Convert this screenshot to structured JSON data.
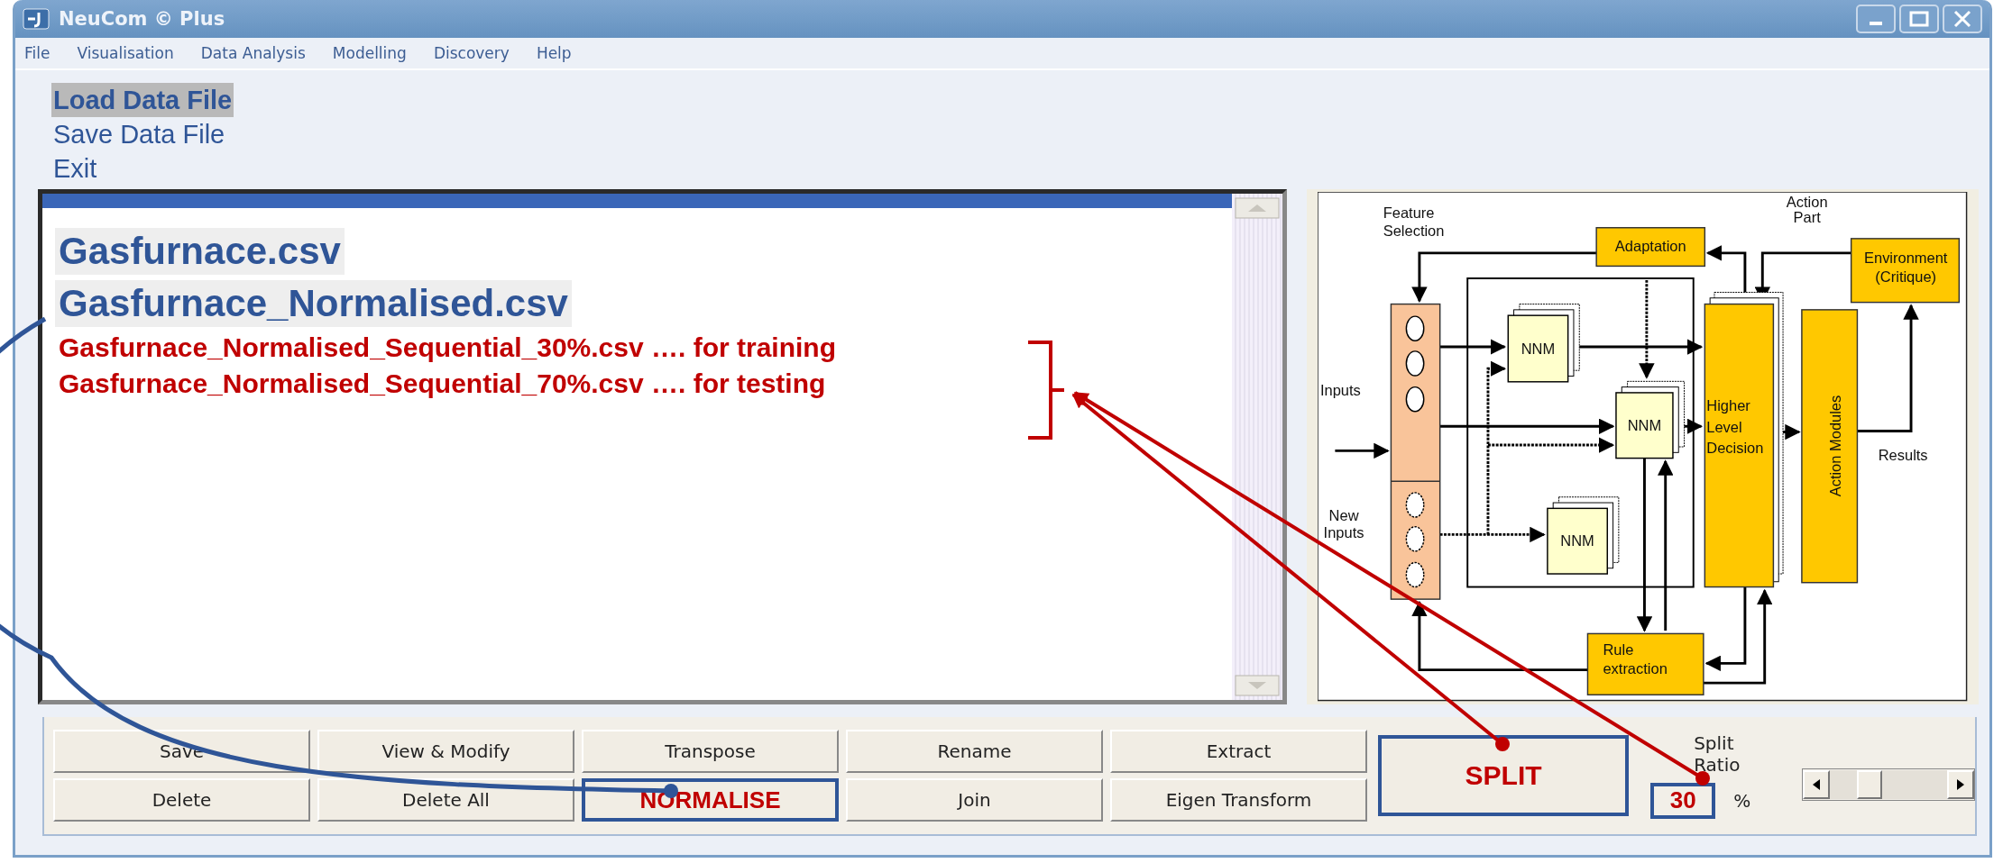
{
  "window": {
    "title": "NeuCom © Plus"
  },
  "menu": [
    {
      "label": "File"
    },
    {
      "label": "Visualisation"
    },
    {
      "label": "Data Analysis"
    },
    {
      "label": "Modelling"
    },
    {
      "label": "Discovery"
    },
    {
      "label": "Help"
    }
  ],
  "file_menu": [
    {
      "label": "Load Data File",
      "selected": true
    },
    {
      "label": "Save Data File",
      "selected": false
    },
    {
      "label": "Exit",
      "selected": false
    }
  ],
  "files": [
    {
      "name": "Gasfurnace.csv",
      "kind": "file"
    },
    {
      "name": "Gasfurnace_Normalised.csv",
      "kind": "file"
    },
    {
      "name": "Gasfurnace_Normalised_Sequential_30%.csv …. for training",
      "kind": "note"
    },
    {
      "name": "Gasfurnace_Normalised_Sequential_70%.csv …. for testing",
      "kind": "note"
    }
  ],
  "diagram": {
    "feature_selection": "Feature Selection",
    "action_part": "Action Part",
    "adaptation": "Adaptation",
    "environment": "Environment (Critique)",
    "inputs": "Inputs",
    "new_inputs": "New Inputs",
    "nnm": [
      "NNM",
      "NNM",
      "NNM"
    ],
    "higher_level_decision": "Higher Level Decision",
    "action_modules": "Action Modules",
    "results": "Results",
    "rule_extraction": "Rule extraction"
  },
  "buttons": [
    {
      "label": "Save",
      "highlighted": false
    },
    {
      "label": "View & Modify",
      "highlighted": false
    },
    {
      "label": "Transpose",
      "highlighted": false
    },
    {
      "label": "Rename",
      "highlighted": false
    },
    {
      "label": "Extract",
      "highlighted": false
    },
    {
      "label": "Delete",
      "highlighted": false
    },
    {
      "label": "Delete All",
      "highlighted": false
    },
    {
      "label": "NORMALISE",
      "highlighted": true
    },
    {
      "label": "Join",
      "highlighted": false
    },
    {
      "label": "Eigen Transform",
      "highlighted": false
    }
  ],
  "split_button": {
    "label": "SPLIT",
    "highlighted": true
  },
  "split_ratio": {
    "label": "Split Ratio",
    "value": "30",
    "unit": "%",
    "highlighted": true
  },
  "slider": {
    "level": 0.3
  }
}
